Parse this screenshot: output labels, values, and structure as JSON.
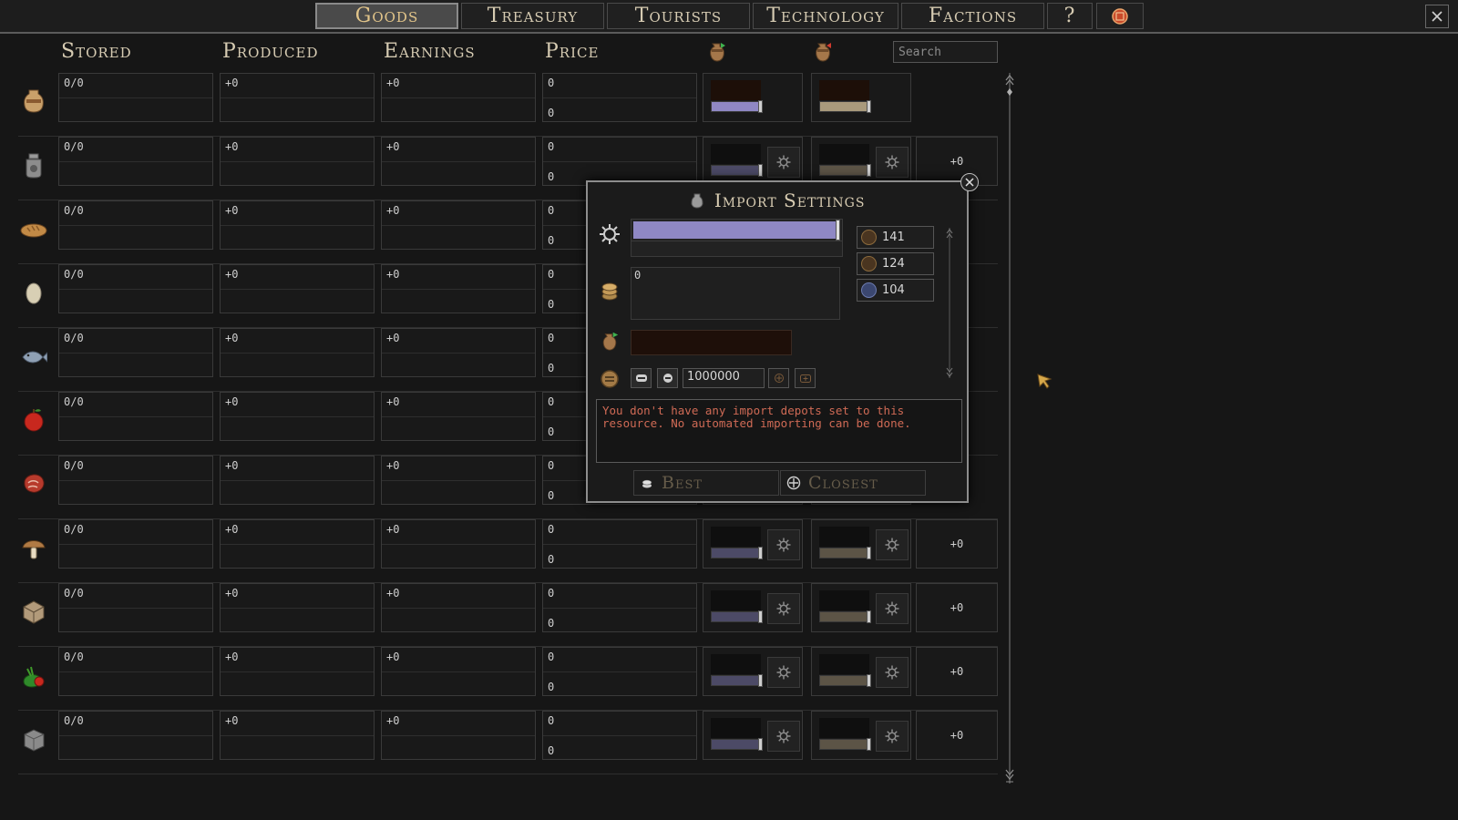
{
  "tabs": [
    {
      "label": "Goods",
      "active": true
    },
    {
      "label": "Treasury",
      "active": false
    },
    {
      "label": "Tourists",
      "active": false
    },
    {
      "label": "Technology",
      "active": false
    },
    {
      "label": "Factions",
      "active": false
    },
    {
      "label": "?",
      "active": false
    }
  ],
  "headers": {
    "stored": "Stored",
    "produced": "Produced",
    "earnings": "Earnings",
    "price": "Price",
    "search_placeholder": "Search"
  },
  "rows": [
    {
      "icon": "amphora-icon",
      "stored": "0/0",
      "produced": "+0",
      "earnings": "+0",
      "price_top": "0",
      "price_bottom": "0",
      "delta": ""
    },
    {
      "icon": "jar-icon",
      "stored": "0/0",
      "produced": "+0",
      "earnings": "+0",
      "price_top": "0",
      "price_bottom": "0",
      "delta": "+0"
    },
    {
      "icon": "bread-icon",
      "stored": "0/0",
      "produced": "+0",
      "earnings": "+0",
      "price_top": "0",
      "price_bottom": "0",
      "delta": ""
    },
    {
      "icon": "egg-icon",
      "stored": "0/0",
      "produced": "+0",
      "earnings": "+0",
      "price_top": "0",
      "price_bottom": "0",
      "delta": ""
    },
    {
      "icon": "fish-icon",
      "stored": "0/0",
      "produced": "+0",
      "earnings": "+0",
      "price_top": "0",
      "price_bottom": "0",
      "delta": ""
    },
    {
      "icon": "apple-icon",
      "stored": "0/0",
      "produced": "+0",
      "earnings": "+0",
      "price_top": "0",
      "price_bottom": "0",
      "delta": ""
    },
    {
      "icon": "meat-icon",
      "stored": "0/0",
      "produced": "+0",
      "earnings": "+0",
      "price_top": "0",
      "price_bottom": "0",
      "delta": ""
    },
    {
      "icon": "mushroom-icon",
      "stored": "0/0",
      "produced": "+0",
      "earnings": "+0",
      "price_top": "0",
      "price_bottom": "0",
      "delta": "+0"
    },
    {
      "icon": "crate-icon",
      "stored": "0/0",
      "produced": "+0",
      "earnings": "+0",
      "price_top": "0",
      "price_bottom": "0",
      "delta": "+0"
    },
    {
      "icon": "vegetables-icon",
      "stored": "0/0",
      "produced": "+0",
      "earnings": "+0",
      "price_top": "0",
      "price_bottom": "0",
      "delta": "+0"
    },
    {
      "icon": "stone-icon",
      "stored": "0/0",
      "produced": "+0",
      "earnings": "+0",
      "price_top": "0",
      "price_bottom": "0",
      "delta": "+0"
    }
  ],
  "dialog": {
    "title": "Import Settings",
    "price_value": "0",
    "quality_level": 0.99,
    "stats": [
      "141",
      "124",
      "104"
    ],
    "amount": "1000000",
    "warning": "You don't have any import depots set to this resource. No automated importing can be done.",
    "best_label": "Best",
    "closest_label": "Closest"
  },
  "colors": {
    "active_tab_text": "#e2c58a",
    "warning_text": "#cf6a55",
    "import_slider": "#8f88c4",
    "export_slider": "#a99a7c"
  }
}
